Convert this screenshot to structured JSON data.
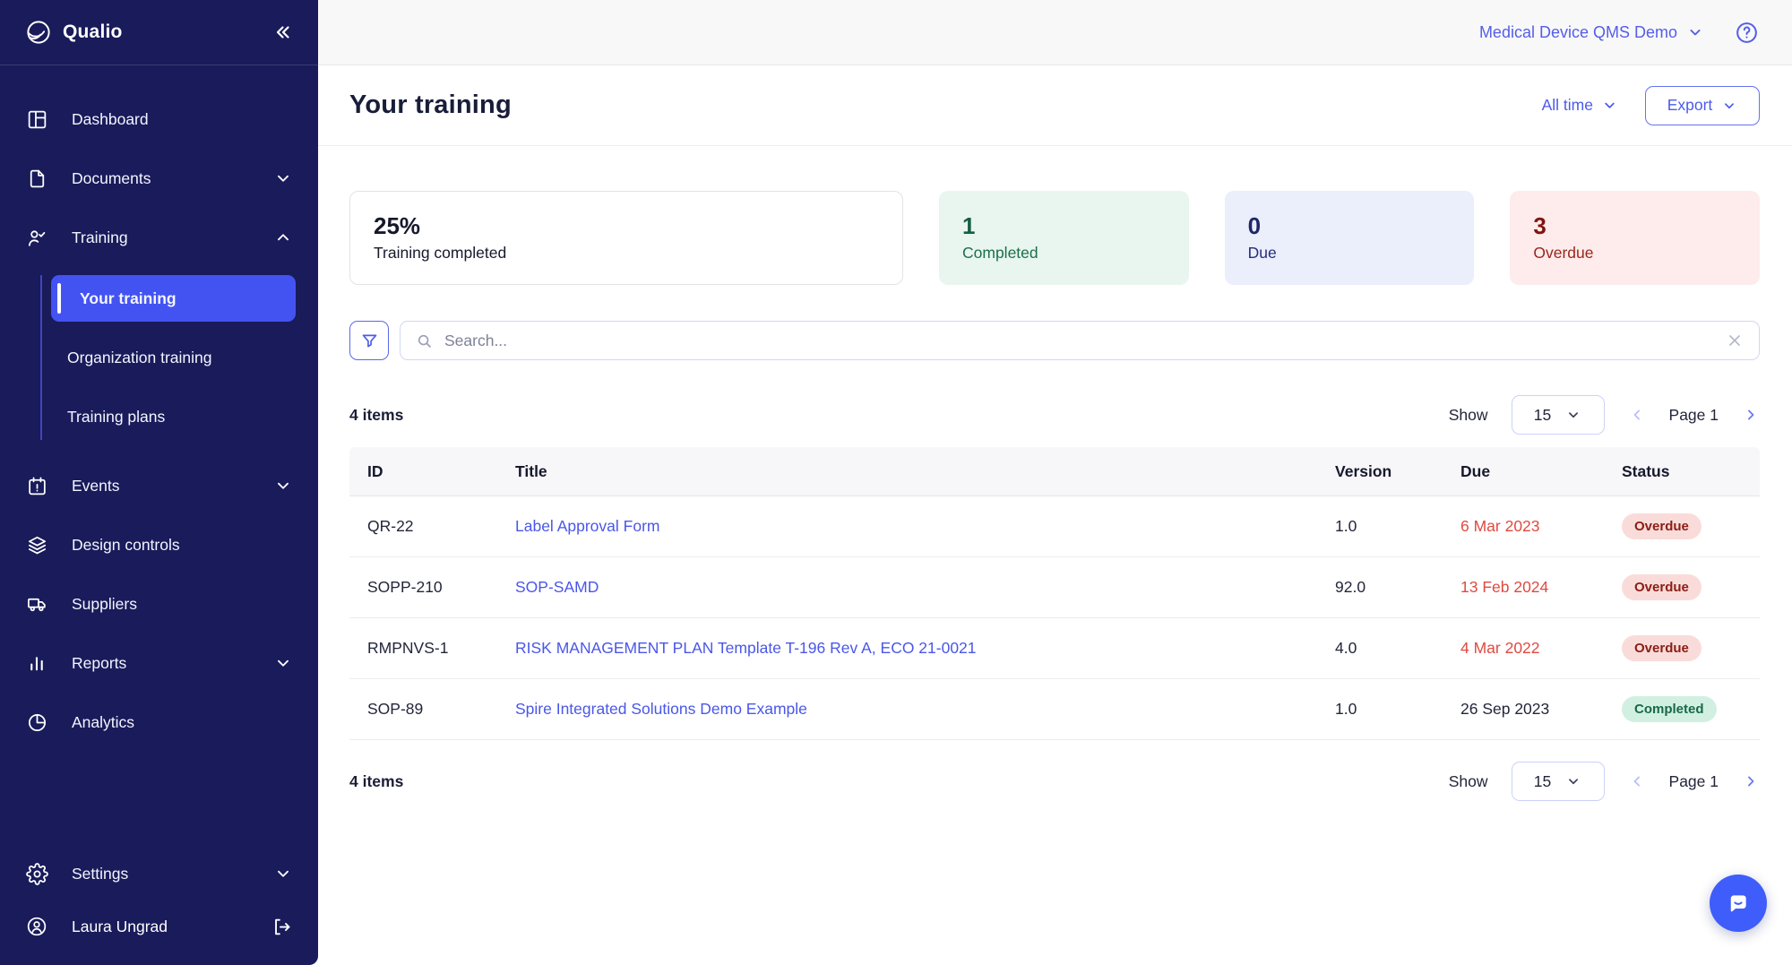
{
  "app": {
    "name": "Qualio"
  },
  "topbar": {
    "workspace": "Medical Device QMS Demo"
  },
  "sidebar": {
    "items": [
      {
        "label": "Dashboard",
        "icon": "dashboard-icon"
      },
      {
        "label": "Documents",
        "icon": "document-icon",
        "chevron": "down"
      },
      {
        "label": "Training",
        "icon": "trainee-check-icon",
        "chevron": "up"
      },
      {
        "label": "Events",
        "icon": "calendar-alert-icon",
        "chevron": "down"
      },
      {
        "label": "Design controls",
        "icon": "layers-icon"
      },
      {
        "label": "Suppliers",
        "icon": "truck-icon"
      },
      {
        "label": "Reports",
        "icon": "bar-chart-icon",
        "chevron": "down"
      },
      {
        "label": "Analytics",
        "icon": "pie-chart-icon"
      },
      {
        "label": "Settings",
        "icon": "gear-icon",
        "chevron": "down"
      }
    ],
    "training_submenu": [
      {
        "label": "Your training",
        "active": true
      },
      {
        "label": "Organization training",
        "active": false
      },
      {
        "label": "Training plans",
        "active": false
      }
    ],
    "user": {
      "name": "Laura Ungrad"
    }
  },
  "page": {
    "title": "Your training",
    "time_filter": "All time",
    "export_label": "Export"
  },
  "stats": [
    {
      "value": "25%",
      "label": "Training completed",
      "variant": "plain"
    },
    {
      "value": "1",
      "label": "Completed",
      "variant": "success"
    },
    {
      "value": "0",
      "label": "Due",
      "variant": "info"
    },
    {
      "value": "3",
      "label": "Overdue",
      "variant": "danger"
    }
  ],
  "search": {
    "placeholder": "Search..."
  },
  "toolbar_top": {
    "items_count": "4 items",
    "show_label": "Show",
    "page_size": "15",
    "page_label": "Page 1"
  },
  "toolbar_bottom": {
    "items_count": "4 items",
    "show_label": "Show",
    "page_size": "15",
    "page_label": "Page 1"
  },
  "table": {
    "columns": [
      "ID",
      "Title",
      "Version",
      "Due",
      "Status"
    ],
    "rows": [
      {
        "id": "QR-22",
        "title": "Label Approval Form",
        "version": "1.0",
        "due": "6 Mar 2023",
        "due_variant": "overdue",
        "status": "Overdue",
        "status_variant": "danger"
      },
      {
        "id": "SOPP-210",
        "title": "SOP-SAMD",
        "version": "92.0",
        "due": "13 Feb 2024",
        "due_variant": "overdue",
        "status": "Overdue",
        "status_variant": "danger"
      },
      {
        "id": "RMPNVS-1",
        "title": "RISK MANAGEMENT PLAN Template T-196 Rev A, ECO 21-0021",
        "version": "4.0",
        "due": "4 Mar 2022",
        "due_variant": "overdue",
        "status": "Overdue",
        "status_variant": "danger"
      },
      {
        "id": "SOP-89",
        "title": "Spire Integrated Solutions Demo Example",
        "version": "1.0",
        "due": "26 Sep 2023",
        "due_variant": "normal",
        "status": "Completed",
        "status_variant": "success"
      }
    ]
  },
  "icons": {
    "collapse": "double-chevron-left-icon",
    "help": "question-circle-icon",
    "filter": "funnel-icon",
    "search": "magnifier-icon",
    "clear": "x-icon",
    "logout": "sign-out-icon",
    "avatar": "avatar-icon",
    "chat": "chat-bubble-icon"
  },
  "colors": {
    "sidebar_bg": "#191b5a",
    "active_item": "#4353f2",
    "accent_indigo": "#4c5bea",
    "overdue_red": "#df4a41",
    "badge_overdue_bg": "#f9dcd9",
    "badge_overdue_text": "#8c1d16",
    "badge_completed_bg": "#d2f0e1",
    "badge_completed_text": "#17694a",
    "card_completed_bg": "#e8f6ef",
    "card_due_bg": "#ebeefb",
    "card_overdue_bg": "#fdeceb",
    "chat_bubble": "#3e5dfa"
  }
}
